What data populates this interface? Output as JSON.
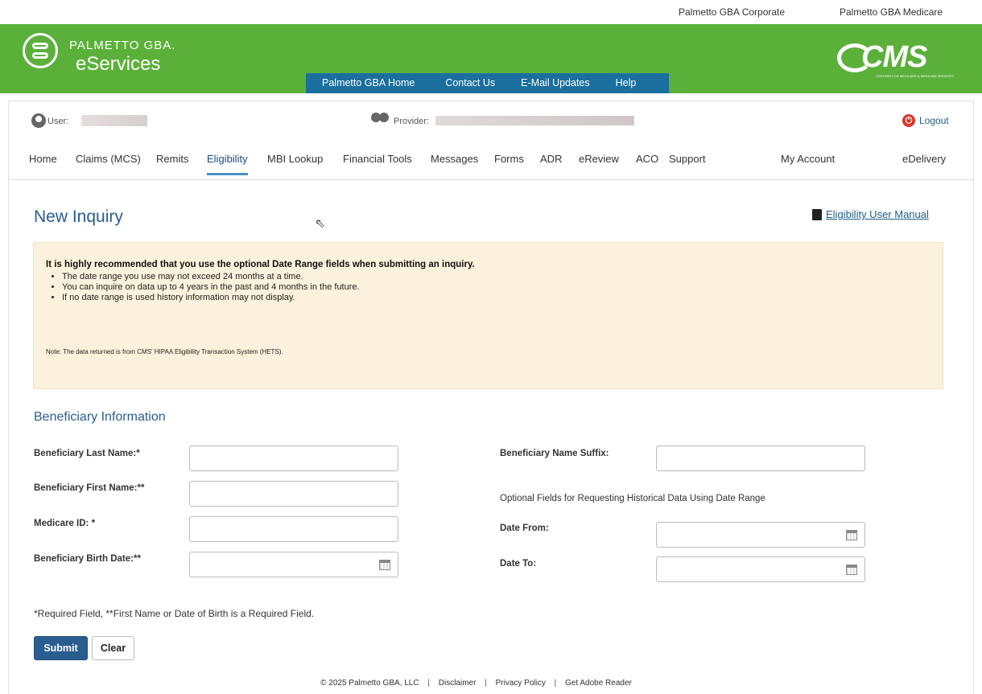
{
  "top_links": {
    "corporate": "Palmetto GBA Corporate",
    "medicare": "Palmetto GBA Medicare"
  },
  "header": {
    "brand_top": "PALMETTO GBA.",
    "brand_bottom": "eServices",
    "cms_text": "CMS",
    "cms_sub": "CENTERS FOR MEDICARE & MEDICAID SERVICES",
    "colors": {
      "green": "#5bb03a",
      "nav_blue": "#1a6f9e"
    },
    "nav": {
      "home": "Palmetto GBA Home",
      "contact": "Contact Us",
      "email": "E-Mail Updates",
      "help": "Help"
    }
  },
  "userbar": {
    "user_label": "User: ",
    "provider_label": "Provider:",
    "logout": "Logout"
  },
  "main_nav": {
    "home": "Home",
    "claims": "Claims (MCS)",
    "remits": "Remits",
    "eligibility": "Eligibility",
    "mbi": "MBI Lookup",
    "financial": "Financial Tools",
    "messages": "Messages",
    "forms": "Forms",
    "adr": "ADR",
    "ereview": "eReview",
    "aco": "ACO",
    "support": "Support",
    "account": "My Account",
    "edelivery": "eDelivery",
    "active": "Eligibility"
  },
  "page": {
    "title": "New Inquiry",
    "manual_link": "Eligibility User Manual"
  },
  "notice": {
    "head": "It is highly recommended that you use the optional Date Range fields when submitting an inquiry.",
    "items": [
      "The date range you use may not exceed 24 months at a time.",
      "You can inquire on data up to 4 years in the past and 4 months in the future.",
      "If no date range is used history information may not display."
    ],
    "note": "Note: The data returned is from CMS' HIPAA Eligibility Transaction System (HETS)."
  },
  "form": {
    "section_title": "Beneficiary Information",
    "last_name_label": "Beneficiary Last Name:*",
    "first_name_label": "Beneficiary First Name:**",
    "medicare_id_label": "Medicare ID: *",
    "birth_date_label": "Beneficiary Birth Date:**",
    "suffix_label": "Beneficiary Name Suffix:",
    "optional_note": "Optional Fields for Requesting Historical Data Using Date Range",
    "date_from_label": "Date From:",
    "date_to_label": "Date To:",
    "last_name_value": "",
    "first_name_value": "",
    "medicare_id_value": "",
    "birth_date_value": "",
    "suffix_value": "",
    "date_from_value": "",
    "date_to_value": "",
    "required_note": "*Required Field, **First Name or Date of Birth is a Required Field.",
    "submit": "Submit",
    "clear": "Clear"
  },
  "footer": {
    "copyright": "© 2025 Palmetto GBA, LLC",
    "disclaimer": "Disclaimer",
    "privacy": "Privacy Policy",
    "adobe": "Get Adobe Reader",
    "separator": "|"
  }
}
